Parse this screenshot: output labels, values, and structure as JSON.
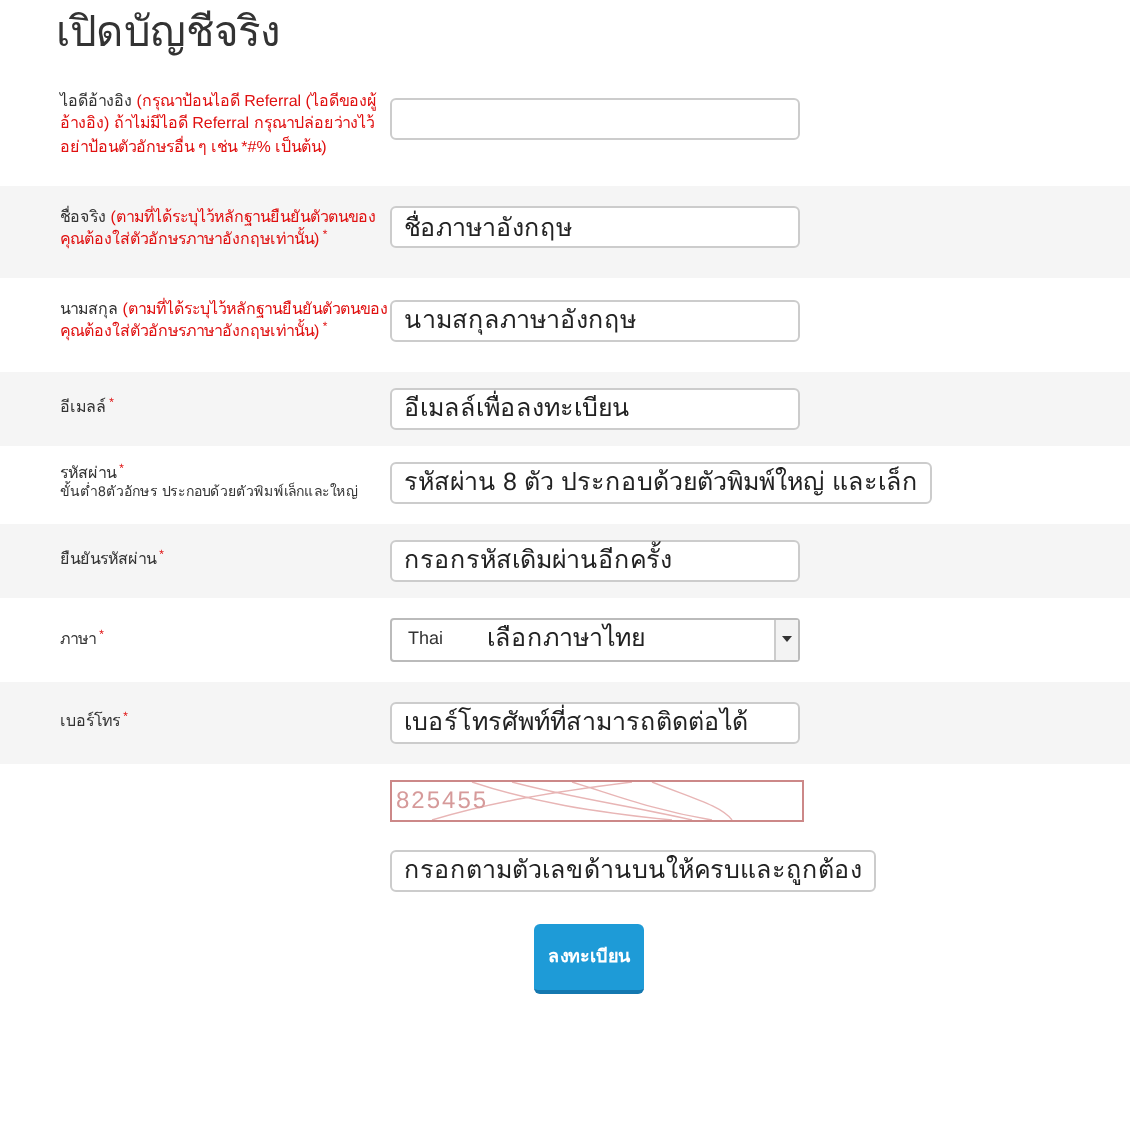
{
  "title": "เปิดบัญชีจริง",
  "fields": [
    {
      "kind": "text",
      "label": "ไอดีอ้างอิง",
      "note": "(กรุณาป้อนไอดี Referral (ไอดีของผู้อ้างอิง) ถ้าไม่มีไอดี Referral กรุณาปล่อยว่างไว้ อย่าป้อนตัวอักษรอื่น ๆ เช่น *#% เป็นต้น)"
    },
    {
      "kind": "text",
      "label": "ชื่อจริง",
      "note": "(ตามที่ได้ระบุไว้หลักฐานยืนยันตัวตนของคุณต้องใส่ตัวอักษรภาษาอังกฤษเท่านั้น)",
      "asterisk": "*",
      "overlay": "ชื่อภาษาอังกฤษ"
    },
    {
      "kind": "text",
      "label": "นามสกุล",
      "note": "(ตามที่ได้ระบุไว้หลักฐานยืนยันตัวตนของคุณต้องใส่ตัวอักษรภาษาอังกฤษเท่านั้น)",
      "asterisk": "*",
      "overlay": "นามสกุลภาษาอังกฤษ"
    },
    {
      "kind": "text",
      "label": "อีเมลล์",
      "asterisk": "*",
      "overlay": "อีเมลล์เพื่อลงทะเบียน"
    },
    {
      "kind": "text",
      "label": "รหัสผ่าน",
      "asterisk": "*",
      "hint": "ขั้นต่ำ8ตัวอักษร ประกอบด้วยตัวพิมพ์เล็กและใหญ่",
      "overlay": "รหัสผ่าน 8 ตัว ประกอบด้วยตัวพิมพ์ใหญ่ และเล็ก"
    },
    {
      "kind": "text",
      "label": "ยืนยันรหัสผ่าน",
      "asterisk": "*",
      "overlay": "กรอกรหัสเดิมผ่านอีกครั้ง"
    },
    {
      "kind": "select",
      "label": "ภาษา",
      "asterisk": "*",
      "value": "Thai",
      "overlay": "เลือกภาษาไทย"
    },
    {
      "kind": "text",
      "label": "เบอร์โทร",
      "asterisk": "*",
      "overlay": "เบอร์โทรศัพท์ที่สามารถติดต่อได้"
    }
  ],
  "captcha": {
    "code": "825455",
    "overlay": "กรอกตามตัวเลขด้านบนให้ครบและถูกต้อง"
  },
  "submit": "ลงทะเบียน"
}
